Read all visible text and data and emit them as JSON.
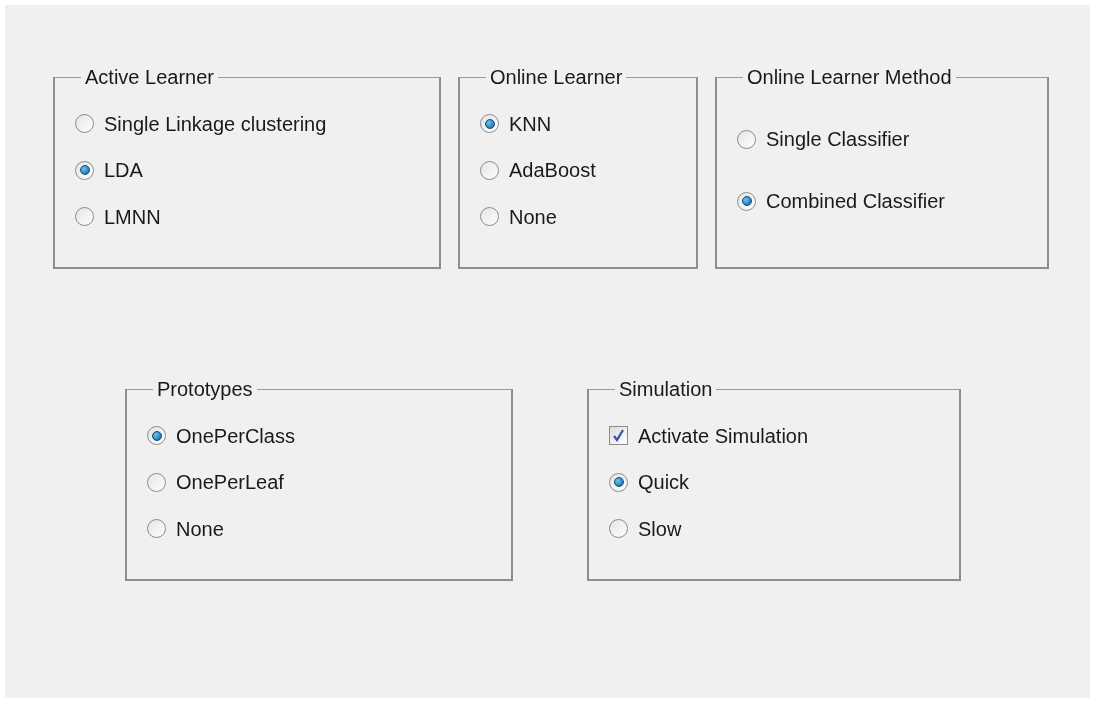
{
  "rows": [
    {
      "groups": [
        {
          "title": "Active Learner",
          "items": [
            {
              "kind": "radio",
              "label": "Single Linkage clustering",
              "selected": false
            },
            {
              "kind": "radio",
              "label": "LDA",
              "selected": true
            },
            {
              "kind": "radio",
              "label": "LMNN",
              "selected": false
            }
          ]
        },
        {
          "title": "Online Learner",
          "items": [
            {
              "kind": "radio",
              "label": "KNN",
              "selected": true
            },
            {
              "kind": "radio",
              "label": "AdaBoost",
              "selected": false
            },
            {
              "kind": "radio",
              "label": "None",
              "selected": false
            }
          ]
        },
        {
          "title": "Online Learner Method",
          "items": [
            {
              "kind": "radio",
              "label": "Single Classifier",
              "selected": false
            },
            {
              "kind": "radio",
              "label": "Combined Classifier",
              "selected": true
            }
          ]
        }
      ]
    },
    {
      "groups": [
        {
          "title": "Prototypes",
          "items": [
            {
              "kind": "radio",
              "label": "OnePerClass",
              "selected": true
            },
            {
              "kind": "radio",
              "label": "OnePerLeaf",
              "selected": false
            },
            {
              "kind": "radio",
              "label": "None",
              "selected": false
            }
          ]
        },
        {
          "title": "Simulation",
          "items": [
            {
              "kind": "checkbox",
              "label": "Activate Simulation",
              "checked": true
            },
            {
              "kind": "radio",
              "label": "Quick",
              "selected": true
            },
            {
              "kind": "radio",
              "label": "Slow",
              "selected": false
            }
          ]
        }
      ]
    }
  ]
}
